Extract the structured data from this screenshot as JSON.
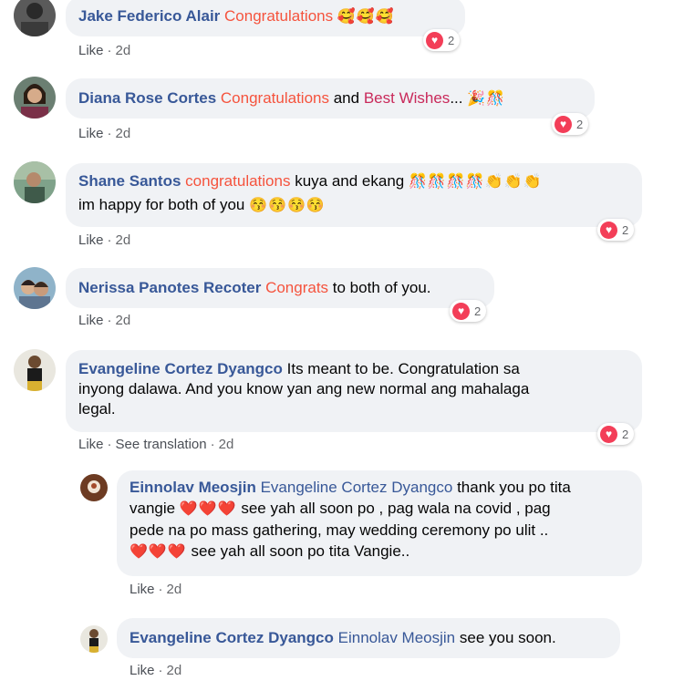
{
  "comments": [
    {
      "author": "Jake Federico Alair",
      "hl": "Congratulations",
      "emoji": "🥰🥰🥰",
      "reactions": "2",
      "like": "Like",
      "time": "2d"
    },
    {
      "author": "Diana Rose Cortes",
      "hl": "Congratulations",
      "and": "and",
      "hl2": "Best Wishes",
      "ellipsis": "...",
      "emoji": "🎉🎊",
      "reactions": "2",
      "like": "Like",
      "time": "2d"
    },
    {
      "author": "Shane Santos",
      "hl": "congratulations",
      "text1": "kuya and ekang",
      "emoji1": "🎊🎊🎊🎊👏👏👏",
      "text2": "im happy for both of you",
      "emoji2": "😚😚😚😚",
      "reactions": "2",
      "like": "Like",
      "time": "2d"
    },
    {
      "author": "Nerissa Panotes Recoter",
      "hl": "Congrats",
      "text": "to both of you.",
      "reactions": "2",
      "like": "Like",
      "time": "2d"
    },
    {
      "author": "Evangeline Cortez Dyangco",
      "line1": "Its meant to be. Congratulation sa",
      "line2": "inyong dalawa. And you know yan ang new normal ang mahalaga",
      "line3": "legal.",
      "reactions": "2",
      "like": "Like",
      "translate": "See translation",
      "time": "2d"
    }
  ],
  "replies": [
    {
      "author": "Einnolav Meosjin",
      "mention": "Evangeline Cortez Dyangco",
      "text1": "thank you po tita",
      "text1b": "vangie",
      "hearts": "❤️❤️❤️",
      "text2": "see yah all soon po , pag wala na covid , pag",
      "text3": "pede na po mass gathering, may wedding ceremony po ulit ..",
      "text4": "see yah all soon po tita Vangie..",
      "like": "Like",
      "time": "2d"
    },
    {
      "author": "Evangeline Cortez Dyangco",
      "mention": "Einnolav Meosjin",
      "text": "see you soon.",
      "like": "Like",
      "time": "2d"
    }
  ],
  "icons": {
    "reaction": "heart-reaction-icon"
  },
  "colors": {
    "author": "#385898",
    "highlight": "#f5533d",
    "highlight2": "#c9295a",
    "bubble": "#f0f2f5",
    "heart": "#f33e58"
  }
}
